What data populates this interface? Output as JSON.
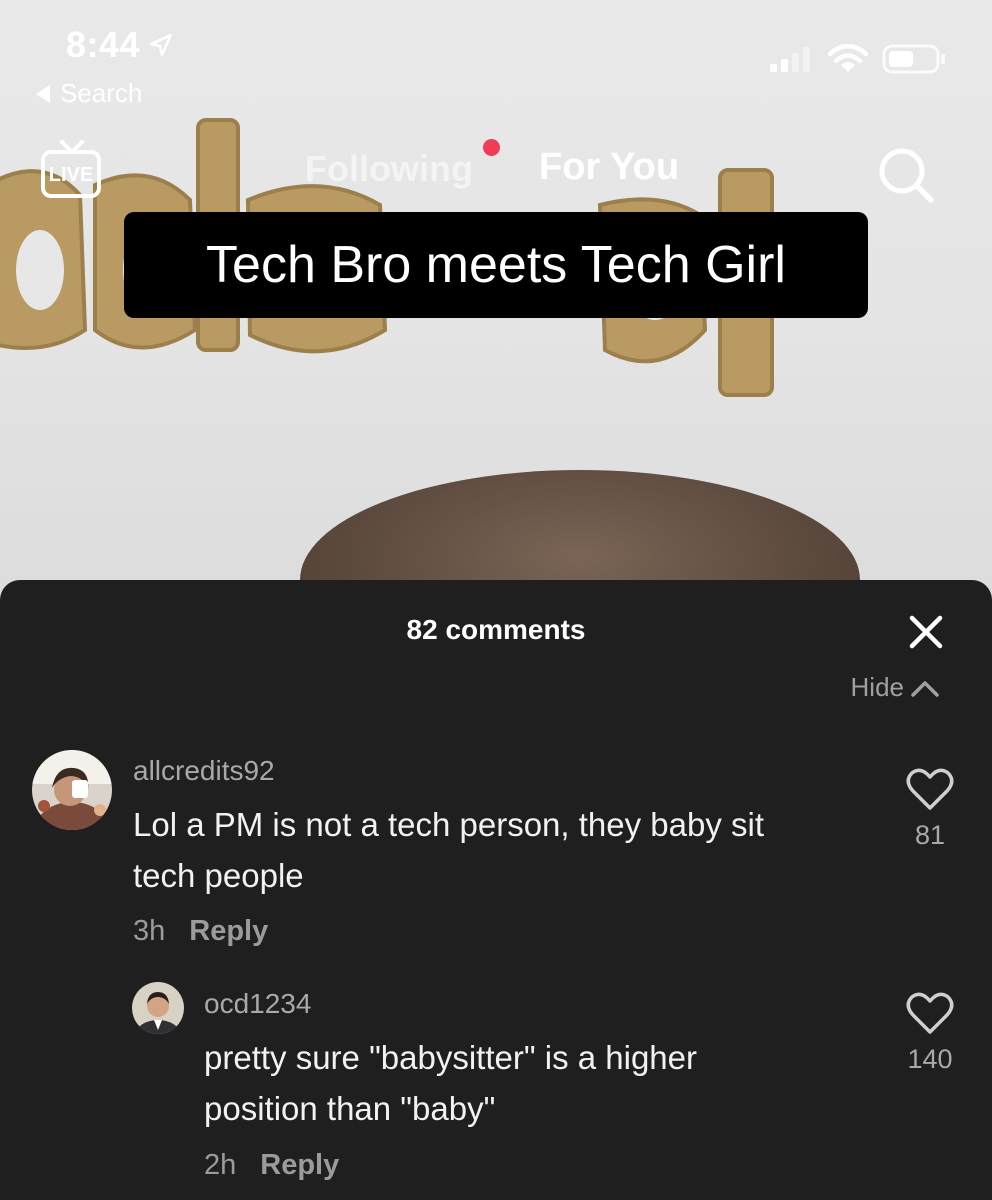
{
  "status_bar": {
    "time": "8:44",
    "back_label": "Search"
  },
  "top_nav": {
    "live_label": "LIVE",
    "tab_following": "Following",
    "tab_for_you": "For You"
  },
  "video": {
    "caption": "Tech Bro meets Tech Girl"
  },
  "comments_sheet": {
    "title": "82 comments",
    "hide_label": "Hide",
    "comments": [
      {
        "username": "allcredits92",
        "text_line1": "Lol a PM is not a tech person, they baby sit",
        "text_line2": "tech people",
        "time": "3h",
        "reply_label": "Reply",
        "likes": "81"
      },
      {
        "username": "ocd1234",
        "text_line1": "pretty sure \"babysitter\" is a higher",
        "text_line2": "position than \"baby\"",
        "time": "2h",
        "reply_label": "Reply",
        "likes": "140"
      }
    ]
  },
  "colors": {
    "sheet_bg": "#1f1f1f",
    "notification_dot": "#ef3d55",
    "caption_bg": "#000000"
  }
}
